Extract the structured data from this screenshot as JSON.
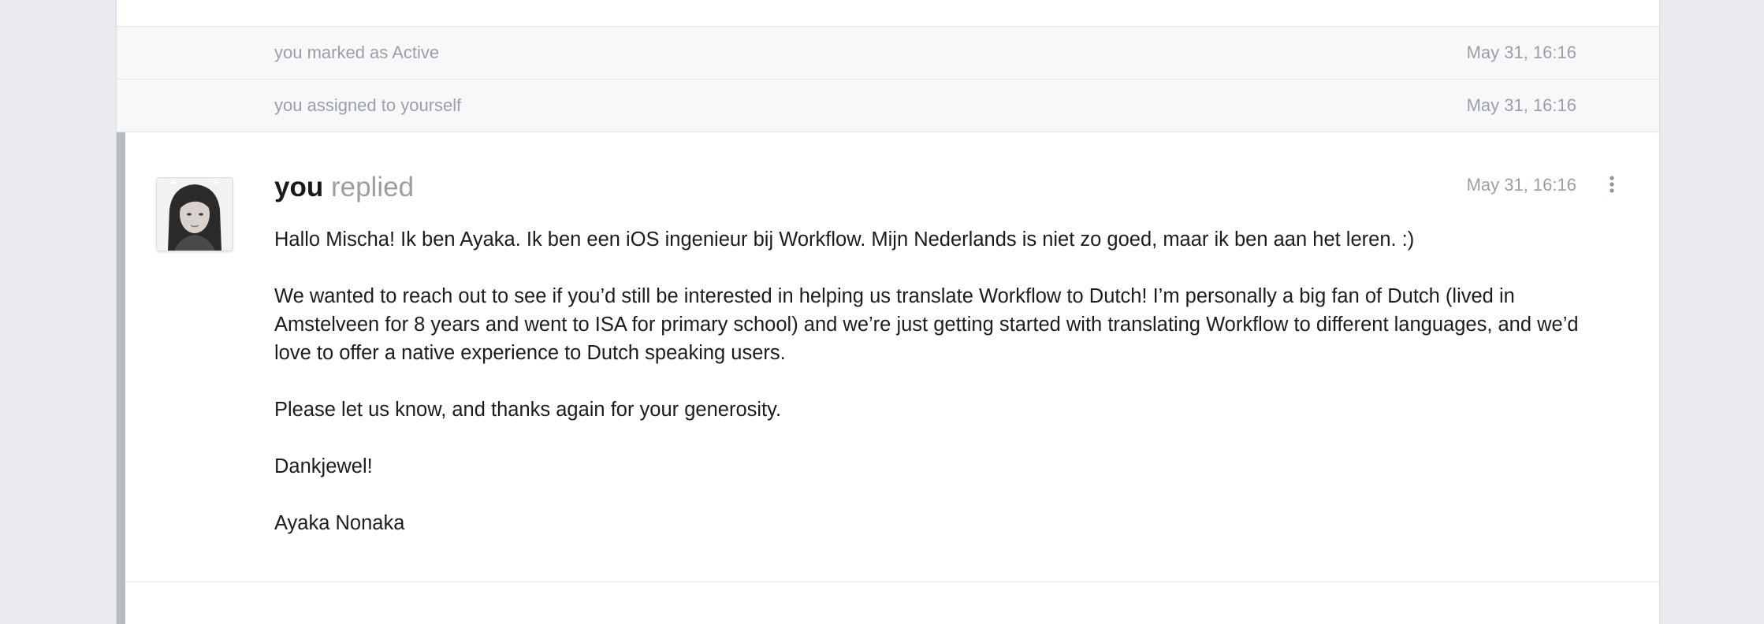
{
  "events": [
    {
      "text": "you marked as Active",
      "time": "May 31, 16:16"
    },
    {
      "text": "you assigned to yourself",
      "time": "May 31, 16:16"
    }
  ],
  "message": {
    "author": "you",
    "action": "replied",
    "time": "May 31, 16:16",
    "more_icon": "vertical-ellipsis-icon",
    "avatar_icon": "user-photo",
    "paragraphs": [
      "Hallo Mischa! Ik ben Ayaka. Ik ben een iOS ingenieur bij Workflow. Mijn Nederlands is niet zo goed, maar ik ben aan het leren. :)",
      "We wanted to reach out to see if you’d still be interested in helping us translate Workflow to Dutch! I’m personally a big fan of Dutch (lived in Amstelveen for 8 years and went to ISA for primary school) and we’re just getting started with translating Workflow to different languages, and we’d love to offer a native experience to Dutch speaking users.",
      "Please let us know, and thanks again for your generosity.",
      "Dankjewel!",
      "Ayaka Nonaka"
    ]
  },
  "colors": {
    "page_background": "#e9ebee",
    "event_row_background": "#f7f8f9",
    "muted_text": "#9a9fa6",
    "accent_bar": "#b7bcc3"
  }
}
